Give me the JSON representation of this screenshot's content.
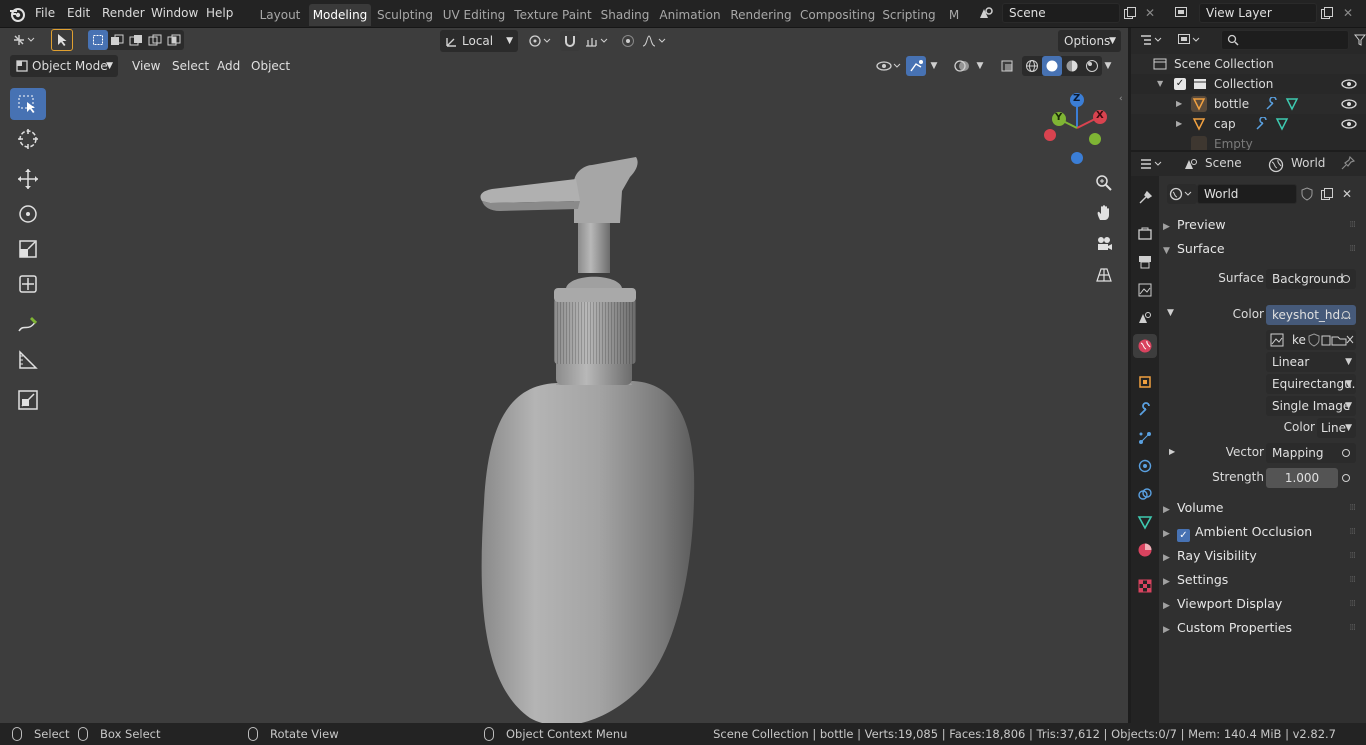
{
  "menubar": {
    "items": [
      "File",
      "Edit",
      "Render",
      "Window",
      "Help"
    ],
    "workspaces": [
      "Layout",
      "Modeling",
      "Sculpting",
      "UV Editing",
      "Texture Paint",
      "Shading",
      "Animation",
      "Rendering",
      "Compositing",
      "Scripting",
      "M"
    ],
    "active_workspace": "Modeling",
    "scene": "Scene",
    "view_layer": "View Layer"
  },
  "viewport": {
    "transform_orientation": "Local",
    "options_label": "Options",
    "mode": "Object Mode",
    "menus": [
      "View",
      "Select",
      "Add",
      "Object"
    ],
    "gizmo": {
      "x": "X",
      "y": "Y",
      "z": "Z"
    }
  },
  "outliner": {
    "root": "Scene Collection",
    "collection": "Collection",
    "objects": [
      "bottle",
      "cap",
      "Empty"
    ]
  },
  "properties": {
    "breadcrumb_scene": "Scene",
    "breadcrumb_world": "World",
    "world_name": "World",
    "panels": {
      "preview": "Preview",
      "surface": "Surface",
      "volume": "Volume",
      "ambient_occlusion": "Ambient Occlusion",
      "ray_visibility": "Ray Visibility",
      "settings": "Settings",
      "viewport_display": "Viewport Display",
      "custom_properties": "Custom Properties"
    },
    "surface_label": "Surface",
    "surface_value": "Background",
    "color_label": "Color",
    "color_value": "keyshot_hd...",
    "image_name": "ke",
    "interpolation": "Linear",
    "projection": "Equirectangu...",
    "source": "Single Image",
    "colorspace_label": "Color",
    "colorspace_value": "Line",
    "vector_label": "Vector",
    "vector_value": "Mapping",
    "strength_label": "Strength",
    "strength_value": "1.000",
    "ambient_occlusion_checked": true
  },
  "statusbar": {
    "select": "Select",
    "box_select": "Box Select",
    "rotate_view": "Rotate View",
    "context_menu": "Object Context Menu",
    "stats": "Scene Collection | bottle | Verts:19,085 | Faces:18,806 | Tris:37,612 | Objects:0/7 | Mem: 140.4 MiB | v2.82.7"
  },
  "colors": {
    "accent": "#4772b3",
    "axis_x": "#d9434f",
    "axis_y": "#7fb534",
    "axis_z": "#3b7ed6",
    "bg_viewport": "#3d3d3d"
  }
}
